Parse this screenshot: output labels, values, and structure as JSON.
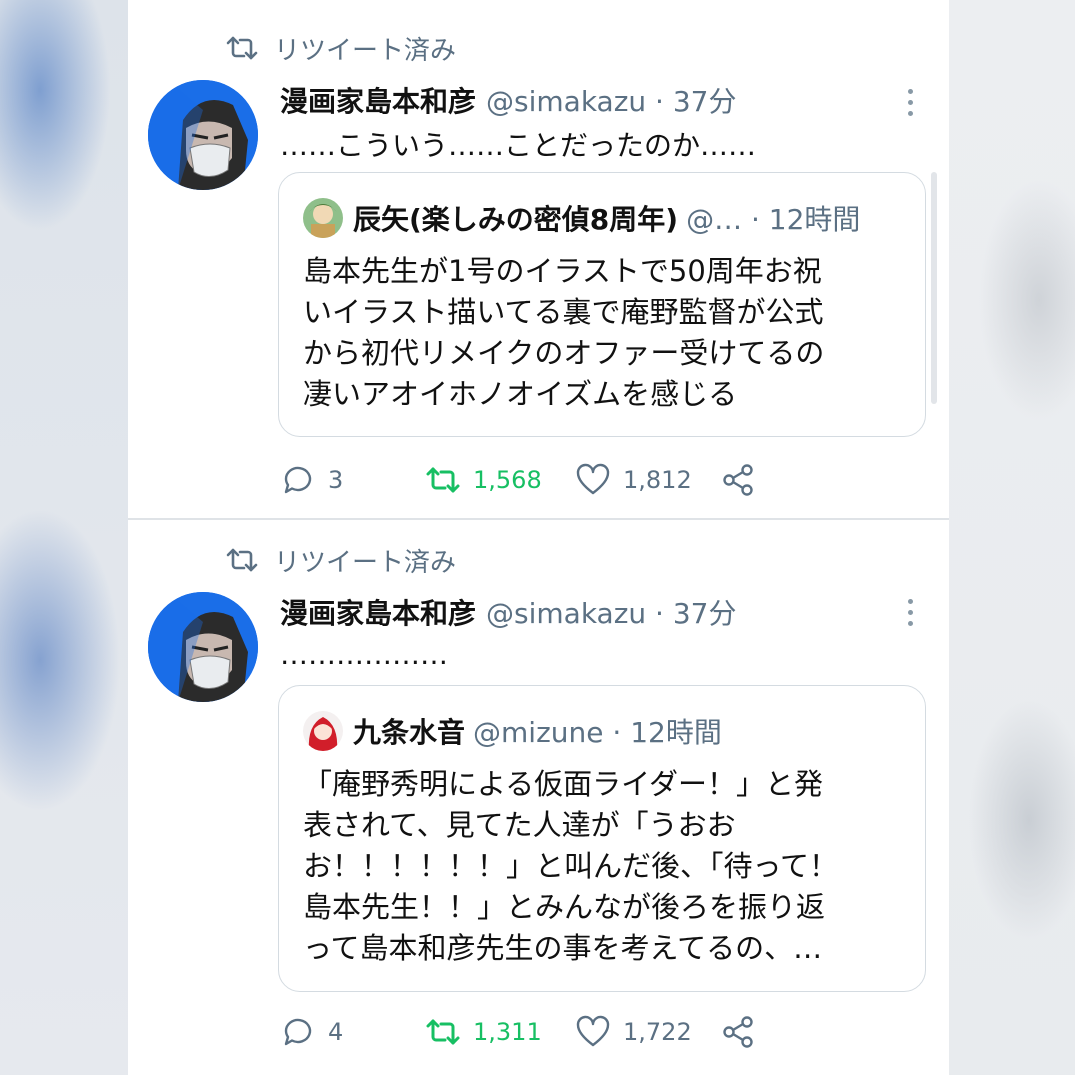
{
  "tweets": [
    {
      "retweet_label": "リツイート済み",
      "author_name": "漫画家島本和彦",
      "meta": "@simakazu · 37分",
      "text": "……こういう……ことだったのか……",
      "quote": {
        "author_name": "辰矢(楽しみの密偵8周年)",
        "meta": "@… · 12時間",
        "text": "島本先生が1号のイラストで50周年お祝\nいイラスト描いてる裏で庵野監督が公式\nから初代リメイクのオファー受けてるの\n凄いアオイホノオイズムを感じる"
      },
      "replies": "3",
      "retweets": "1,568",
      "likes": "1,812"
    },
    {
      "retweet_label": "リツイート済み",
      "author_name": "漫画家島本和彦",
      "meta": "@simakazu · 37分",
      "text": "………………",
      "quote": {
        "author_name": "九条水音",
        "meta": "@mizune · 12時間",
        "text": "「庵野秀明による仮面ライダー！」と発\n表されて、見てた人達が「うおお\nお！！！！！！」と叫んだ後、「待って！\n島本先生！！」とみんなが後ろを振り返\nって島本和彦先生の事を考えてるの、…"
      },
      "replies": "4",
      "retweets": "1,311",
      "likes": "1,722"
    }
  ],
  "colors": {
    "text": "#111111",
    "secondary": "#5b7083",
    "retweet_green": "#17bf63",
    "border": "#d4dbe1"
  },
  "icons": [
    "retweet-icon",
    "more-icon",
    "reply-icon",
    "like-icon",
    "share-icon"
  ]
}
